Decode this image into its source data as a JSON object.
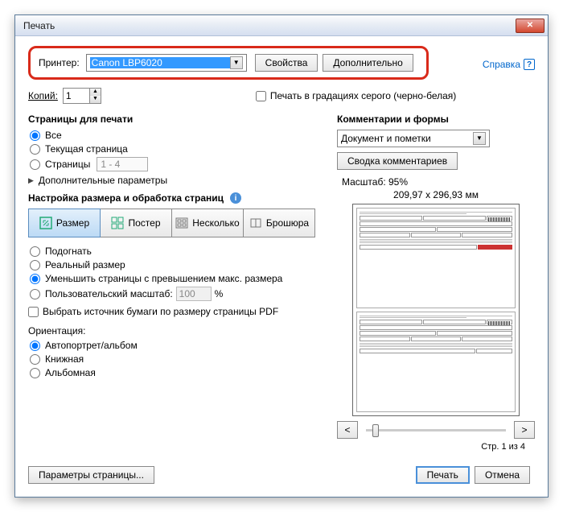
{
  "titlebar": {
    "title": "Печать"
  },
  "help_link": "Справка",
  "printer": {
    "label": "Принтер:",
    "selected": "Canon LBP6020",
    "properties_btn": "Свойства",
    "advanced_btn": "Дополнительно"
  },
  "copies": {
    "label": "Копий:",
    "value": "1"
  },
  "grayscale_label": "Печать в градациях серого (черно-белая)",
  "pages": {
    "title": "Страницы для печати",
    "all": "Все",
    "current": "Текущая страница",
    "range": "Страницы",
    "range_value": "1 - 4",
    "more": "Дополнительные параметры"
  },
  "sizing": {
    "title": "Настройка размера и обработка страниц",
    "size": "Размер",
    "poster": "Постер",
    "multiple": "Несколько",
    "booklet": "Брошюра",
    "fit": "Подогнать",
    "actual": "Реальный размер",
    "shrink": "Уменьшить страницы с превышением макс. размера",
    "custom": "Пользовательский масштаб:",
    "custom_value": "100",
    "custom_unit": "%",
    "paper_source": "Выбрать источник бумаги по размеру страницы PDF"
  },
  "orientation": {
    "label": "Ориентация:",
    "auto": "Автопортрет/альбом",
    "portrait": "Книжная",
    "landscape": "Альбомная"
  },
  "comments": {
    "title": "Комментарии и формы",
    "selected": "Документ и пометки",
    "summary_btn": "Сводка комментариев"
  },
  "preview": {
    "scale": "Масштаб:  95%",
    "paper": "209,97 x 296,93 мм",
    "page_info": "Стр. 1 из 4"
  },
  "footer": {
    "page_setup": "Параметры страницы...",
    "print": "Печать",
    "cancel": "Отмена"
  }
}
